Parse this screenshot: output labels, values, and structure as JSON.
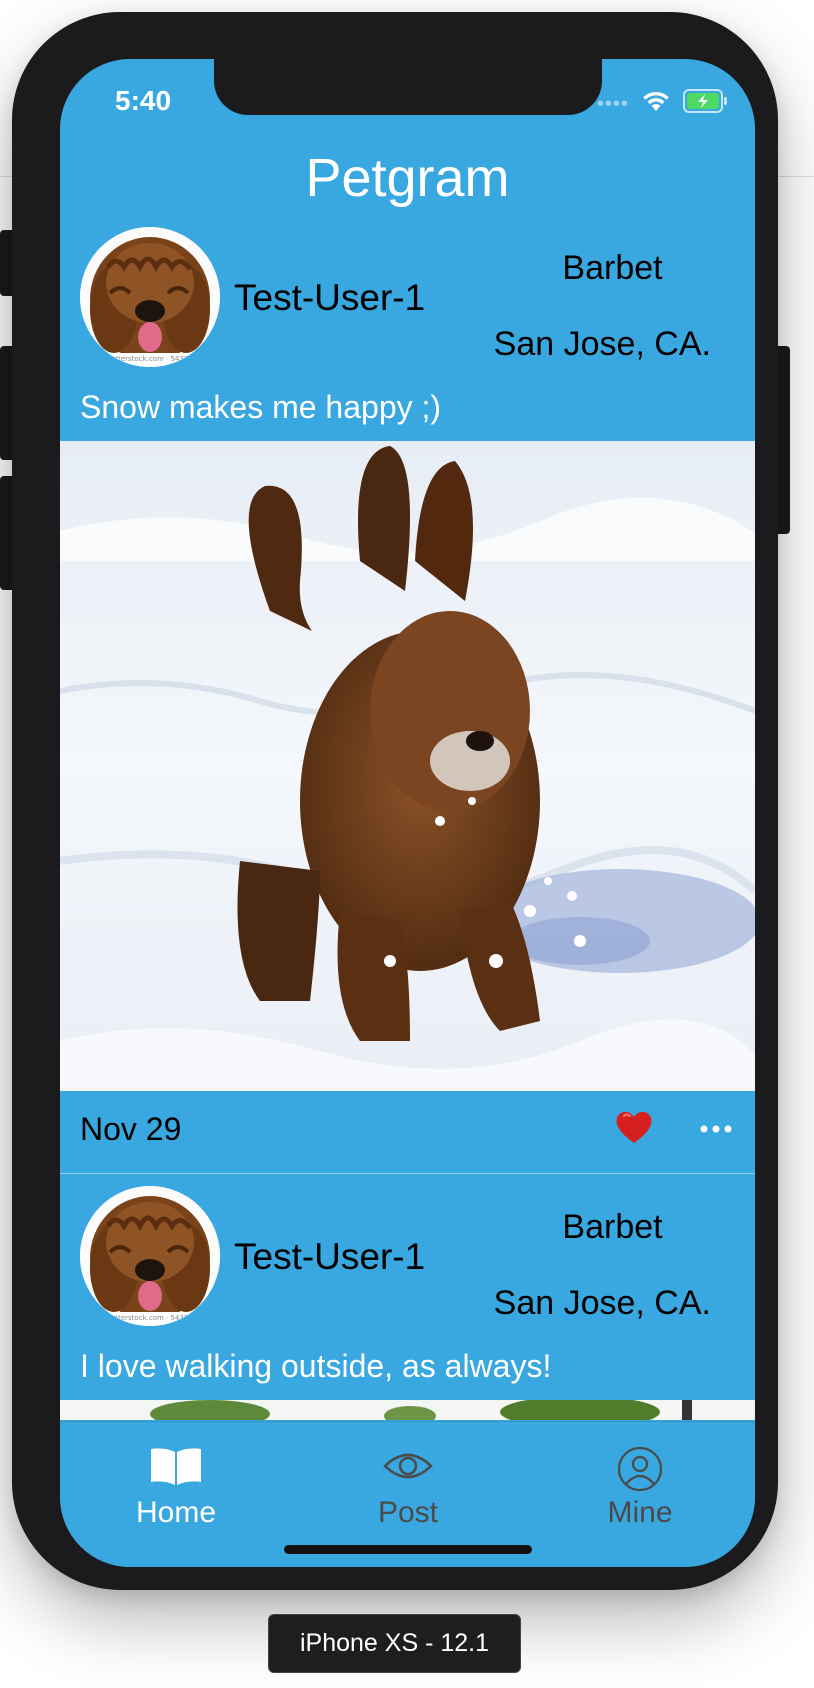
{
  "status_bar": {
    "time": "5:40",
    "signal_dots": "••••",
    "icons": [
      "wifi-icon",
      "battery-charging-icon"
    ]
  },
  "app": {
    "title": "Petgram"
  },
  "posts": [
    {
      "username": "Test-User-1",
      "breed": "Barbet",
      "location": "San Jose, CA.",
      "caption": "Snow makes me happy ;)",
      "date": "Nov 29",
      "liked": true
    },
    {
      "username": "Test-User-1",
      "breed": "Barbet",
      "location": "San Jose, CA.",
      "caption": "I love walking outside, as always!"
    }
  ],
  "tabs": [
    {
      "label": "Home",
      "icon": "book-icon",
      "active": true
    },
    {
      "label": "Post",
      "icon": "eye-icon",
      "active": false
    },
    {
      "label": "Mine",
      "icon": "user-icon",
      "active": false
    }
  ],
  "device_label": "iPhone XS - 12.1",
  "colors": {
    "accent": "#39a8e0",
    "heart": "#d6201f",
    "inactive_tab": "#4a4a4a",
    "device_frame": "#1b1b1d"
  }
}
